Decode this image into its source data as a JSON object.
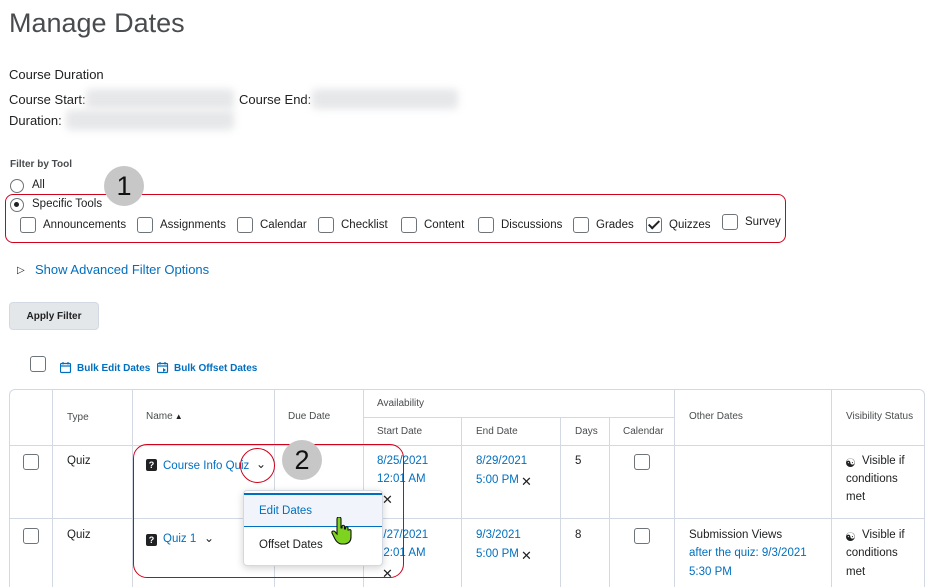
{
  "page": {
    "title": "Manage Dates"
  },
  "course": {
    "heading": "Course Duration",
    "start_label": "Course Start:",
    "end_label": "Course End:",
    "duration_label": "Duration:"
  },
  "filter": {
    "label": "Filter by Tool",
    "option_all": "All",
    "option_specific": "Specific Tools",
    "selected": "Specific Tools",
    "tools": [
      {
        "label": "Announcements",
        "checked": false
      },
      {
        "label": "Assignments",
        "checked": false
      },
      {
        "label": "Calendar",
        "checked": false
      },
      {
        "label": "Checklist",
        "checked": false
      },
      {
        "label": "Content",
        "checked": false
      },
      {
        "label": "Discussions",
        "checked": false
      },
      {
        "label": "Grades",
        "checked": false
      },
      {
        "label": "Quizzes",
        "checked": true
      },
      {
        "label": "Survey",
        "checked": false
      }
    ],
    "advanced_link": "Show Advanced Filter Options",
    "apply_button": "Apply Filter"
  },
  "annotations": {
    "badge1": "1",
    "badge2": "2"
  },
  "bulk": {
    "edit": "Bulk Edit Dates",
    "offset": "Bulk Offset Dates"
  },
  "table": {
    "headers": {
      "type": "Type",
      "name": "Name",
      "due_date": "Due Date",
      "availability": "Availability",
      "start_date": "Start Date",
      "end_date": "End Date",
      "days": "Days",
      "calendar": "Calendar",
      "other_dates": "Other Dates",
      "visibility": "Visibility Status"
    },
    "rows": [
      {
        "type": "Quiz",
        "name": "Course Info Quiz",
        "start_date": "8/25/2021",
        "start_time": "12:01 AM",
        "end_date": "8/29/2021",
        "end_time": "5:00 PM",
        "days": "5",
        "other_label": "",
        "other_link": "",
        "other_time": "",
        "vis1": "Visible if",
        "vis2": "conditions",
        "vis3": "met"
      },
      {
        "type": "Quiz",
        "name": "Quiz 1",
        "start_date": "8/27/2021",
        "start_time": "12:01 AM",
        "end_date": "9/3/2021",
        "end_time": "5:00 PM",
        "days": "8",
        "other_label": "Submission Views",
        "other_link": "after the quiz: 9/3/2021",
        "other_time": "5:30 PM",
        "vis1": "Visible if",
        "vis2": "conditions",
        "vis3": "met"
      }
    ]
  },
  "context_menu": {
    "items": [
      "Edit Dates",
      "Offset Dates"
    ],
    "active": "Edit Dates"
  },
  "colors": {
    "link": "#006fbf",
    "annotation_red": "#d0021b",
    "grid": "#d3d9e3"
  }
}
